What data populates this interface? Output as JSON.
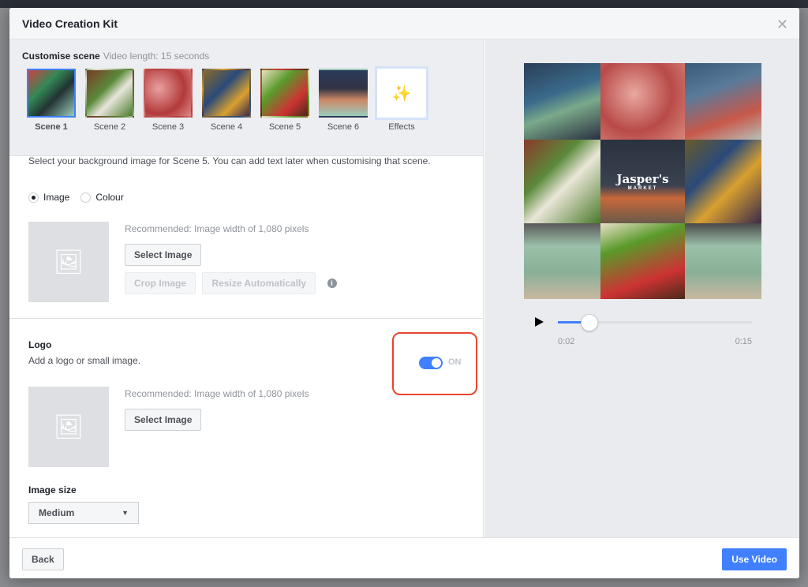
{
  "modal": {
    "title": "Video Creation Kit",
    "close_icon": "close-icon"
  },
  "scenes": {
    "heading": "Customise scene",
    "length": "Video length: 15 seconds",
    "items": [
      {
        "label": "Scene 1",
        "selected": true
      },
      {
        "label": "Scene 2"
      },
      {
        "label": "Scene 3"
      },
      {
        "label": "Scene 4"
      },
      {
        "label": "Scene 5"
      },
      {
        "label": "Scene 6"
      }
    ],
    "effects_label": "Effects",
    "effects_icon": "magic-wand-icon"
  },
  "background": {
    "description": "Select your background image for Scene 5. You can add text later when customising that scene.",
    "options": [
      {
        "label": "Image",
        "selected": true
      },
      {
        "label": "Colour",
        "selected": false
      }
    ],
    "recommended": "Recommended: Image width of 1,080 pixels",
    "select_image": "Select Image",
    "crop_image": "Crop Image",
    "resize_auto": "Resize Automatically"
  },
  "logo": {
    "title": "Logo",
    "description": "Add a logo or small image.",
    "toggle_label": "ON",
    "toggle_on": true,
    "recommended": "Recommended: Image width of 1,080 pixels",
    "select_image": "Select Image",
    "size_label": "Image size",
    "size_value": "Medium"
  },
  "preview": {
    "logo_text": "Jasper's",
    "logo_sub": "MARKET",
    "current_time": "0:02",
    "total_time": "0:15",
    "progress": 0.133
  },
  "footer": {
    "back": "Back",
    "use_video": "Use Video"
  },
  "colors": {
    "accent": "#4080ff",
    "highlight": "#e9452d"
  }
}
